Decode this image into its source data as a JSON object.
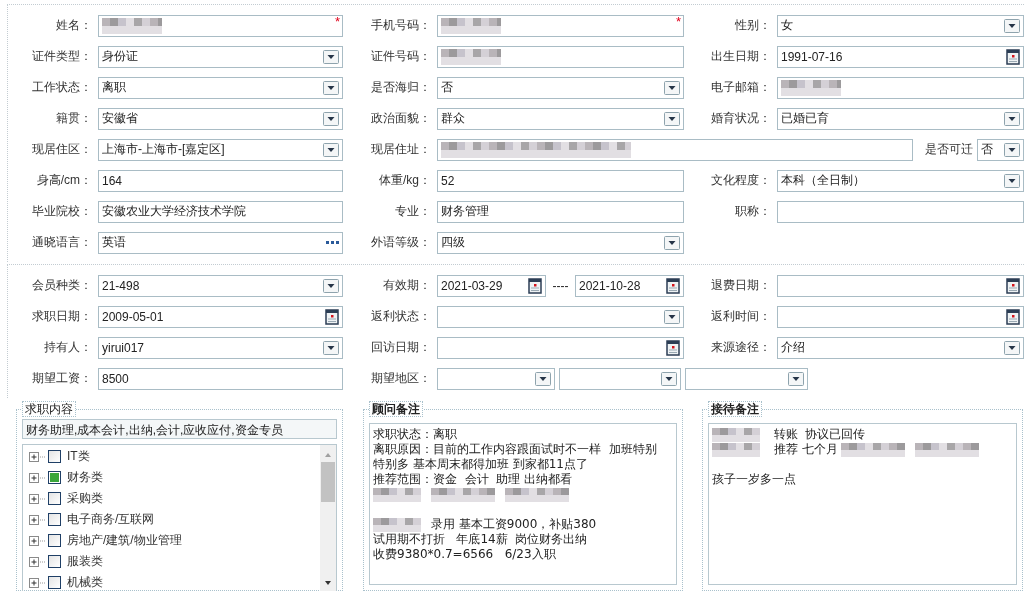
{
  "sections": [
    {
      "rows": [
        {
          "kind": "standard",
          "fields": [
            {
              "kind": "text",
              "label": "姓名：",
              "redacted": true,
              "required_mark": "*"
            },
            {
              "kind": "text",
              "label": "手机号码：",
              "redacted": true,
              "required_mark": "*"
            },
            {
              "kind": "select",
              "label": "性别：",
              "value": "女"
            }
          ]
        },
        {
          "kind": "standard",
          "fields": [
            {
              "kind": "select",
              "label": "证件类型：",
              "value": "身份证"
            },
            {
              "kind": "text",
              "label": "证件号码：",
              "redacted": true
            },
            {
              "kind": "date",
              "label": "出生日期：",
              "value": "1991-07-16"
            }
          ]
        },
        {
          "kind": "standard",
          "fields": [
            {
              "kind": "select",
              "label": "工作状态：",
              "value": "离职"
            },
            {
              "kind": "select",
              "label": "是否海归：",
              "value": "否"
            },
            {
              "kind": "text",
              "label": "电子邮箱：",
              "redacted": true
            }
          ]
        },
        {
          "kind": "standard",
          "fields": [
            {
              "kind": "select",
              "label": "籍贯：",
              "value": "安徽省"
            },
            {
              "kind": "select",
              "label": "政治面貌：",
              "value": "群众"
            },
            {
              "kind": "select",
              "label": "婚育状况：",
              "value": "已婚已育"
            }
          ]
        },
        {
          "kind": "address",
          "fields": [
            {
              "kind": "select",
              "label": "现居住区：",
              "value": "上海市-上海市-[嘉定区]"
            },
            {
              "kind": "text",
              "label": "现居住址：",
              "redacted": true
            },
            {
              "kind": "select",
              "label": "是否可迁",
              "value": "否"
            }
          ]
        },
        {
          "kind": "standard",
          "fields": [
            {
              "kind": "text",
              "label": "身高/cm：",
              "value": "164"
            },
            {
              "kind": "text",
              "label": "体重/kg：",
              "value": "52"
            },
            {
              "kind": "select",
              "label": "文化程度：",
              "value": "本科（全日制）"
            }
          ]
        },
        {
          "kind": "standard",
          "fields": [
            {
              "kind": "text",
              "label": "毕业院校：",
              "value": "安徽农业大学经济技术学院"
            },
            {
              "kind": "text",
              "label": "专业：",
              "value": "财务管理"
            },
            {
              "kind": "text",
              "label": "职称："
            }
          ]
        },
        {
          "kind": "standard",
          "fields": [
            {
              "kind": "picker",
              "label": "通晓语言：",
              "value": "英语"
            },
            {
              "kind": "select",
              "label": "外语等级：",
              "value": "四级"
            }
          ]
        }
      ]
    },
    {
      "rows": [
        {
          "kind": "standard",
          "fields": [
            {
              "kind": "select",
              "label": "会员种类：",
              "value": "21-498"
            },
            {
              "kind": "date-range",
              "label": "有效期：",
              "values": [
                "2021-03-29",
                "2021-10-28"
              ],
              "separator": "----"
            },
            {
              "kind": "date",
              "label": "退费日期："
            }
          ]
        },
        {
          "kind": "standard",
          "fields": [
            {
              "kind": "date",
              "label": "求职日期：",
              "value": "2009-05-01"
            },
            {
              "kind": "select",
              "label": "返利状态："
            },
            {
              "kind": "date",
              "label": "返利时间："
            }
          ]
        },
        {
          "kind": "standard",
          "fields": [
            {
              "kind": "select",
              "label": "持有人：",
              "value": "yirui017"
            },
            {
              "kind": "date",
              "label": "回访日期："
            },
            {
              "kind": "select",
              "label": "来源途径：",
              "value": "介绍"
            }
          ]
        },
        {
          "kind": "standard",
          "fields": [
            {
              "kind": "text",
              "label": "期望工资：",
              "value": "8500"
            },
            {
              "kind": "triple-select",
              "label": "期望地区："
            }
          ]
        }
      ]
    }
  ],
  "job_panel": {
    "title": "求职内容",
    "summary": "财务助理,成本会计,出纳,会计,应收应付,资金专员",
    "items": [
      {
        "label": "IT类",
        "checked": false
      },
      {
        "label": "财务类",
        "checked": true
      },
      {
        "label": "采购类",
        "checked": false
      },
      {
        "label": "电子商务/互联网",
        "checked": false
      },
      {
        "label": "房地产/建筑/物业管理",
        "checked": false
      },
      {
        "label": "服装类",
        "checked": false
      },
      {
        "label": "机械类",
        "checked": false
      }
    ]
  },
  "notes_panels": [
    {
      "title": "顾问备注",
      "lines": [
        {
          "kind": "text",
          "text": "求职状态：离职"
        },
        {
          "kind": "text",
          "text": "离职原因：目前的工作内容跟面试时不一样  加班特别"
        },
        {
          "kind": "text",
          "text": "特别多 基本周末都得加班 到家都11点了"
        },
        {
          "kind": "text",
          "text": "推荐范围：资金  会计  助理 出纳都看"
        },
        {
          "kind": "mixed",
          "parts": [
            {
              "kind": "redacted"
            },
            {
              "kind": "redacted"
            },
            {
              "kind": "redacted"
            }
          ]
        },
        {
          "kind": "blank"
        },
        {
          "kind": "mixed",
          "parts": [
            {
              "kind": "redacted"
            },
            {
              "kind": "text",
              "text": "录用 基本工资9000，补贴380"
            }
          ]
        },
        {
          "kind": "text",
          "text": "试用期不打折   年底14薪  岗位财务出纳"
        },
        {
          "kind": "text",
          "text": "收费9380*0.7=6566   6/23入职"
        }
      ]
    },
    {
      "title": "接待备注",
      "lines": [
        {
          "kind": "mixed",
          "parts": [
            {
              "kind": "redacted"
            },
            {
              "kind": "text",
              "text": " 转账  协议已回传"
            }
          ]
        },
        {
          "kind": "mixed",
          "parts": [
            {
              "kind": "redacted"
            },
            {
              "kind": "text",
              "text": " 推荐 七个月 "
            },
            {
              "kind": "redacted"
            },
            {
              "kind": "redacted"
            }
          ]
        },
        {
          "kind": "blank"
        },
        {
          "kind": "text",
          "text": "孩子一岁多一点"
        }
      ]
    }
  ]
}
